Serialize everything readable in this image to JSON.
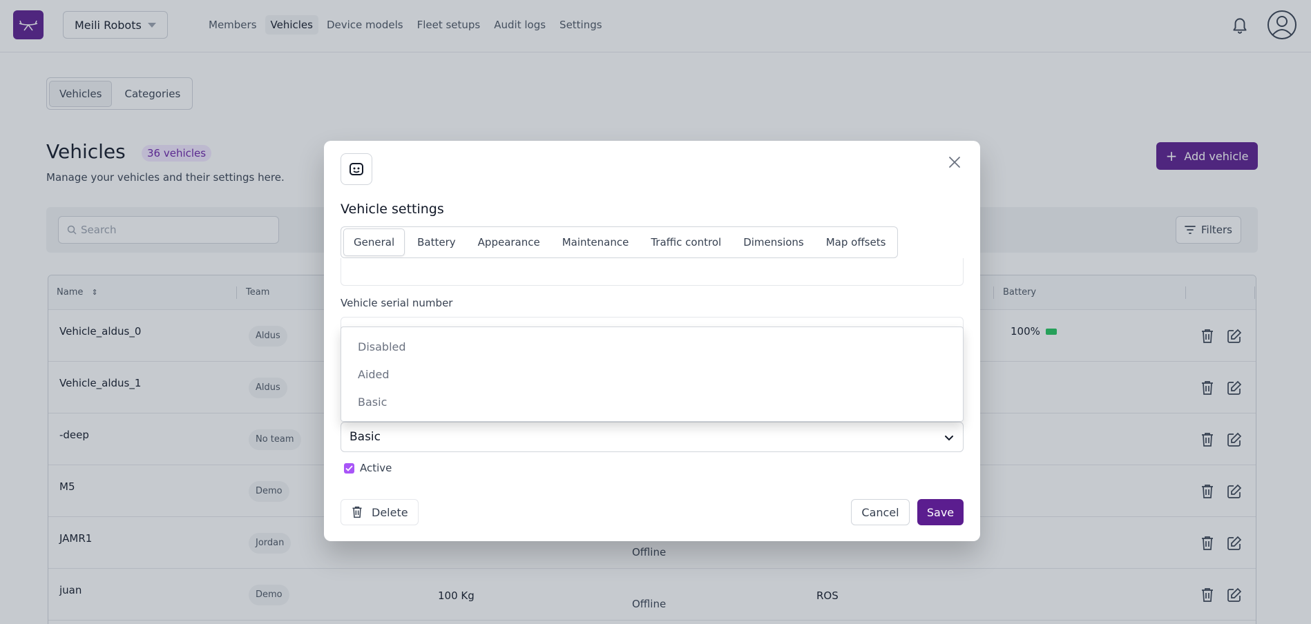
{
  "header": {
    "org_name": "Meili Robots",
    "nav": [
      "Members",
      "Vehicles",
      "Device models",
      "Fleet setups",
      "Audit logs",
      "Settings"
    ],
    "active_nav": "Vehicles"
  },
  "segmented": [
    "Vehicles",
    "Categories"
  ],
  "page": {
    "title": "Vehicles",
    "count_badge": "36 vehicles",
    "subtitle": "Manage your vehicles and their settings here.",
    "add_button": "Add vehicle",
    "search_placeholder": "Search",
    "filters_label": "Filters"
  },
  "table": {
    "headers": {
      "name": "Name",
      "team": "Team",
      "battery": "Battery"
    },
    "rows": [
      {
        "name": "Vehicle_aldus_0",
        "team": "Aldus",
        "payload": "",
        "status": "",
        "protocol": "",
        "battery": "100%"
      },
      {
        "name": "Vehicle_aldus_1",
        "team": "Aldus",
        "payload": "",
        "status": "",
        "protocol": "",
        "battery": ""
      },
      {
        "name": "-deep",
        "team": "No team",
        "payload": "",
        "status": "",
        "protocol": "",
        "battery": ""
      },
      {
        "name": "M5",
        "team": "Demo",
        "payload": "",
        "status": "",
        "protocol": "",
        "battery": ""
      },
      {
        "name": "JAMR1",
        "team": "Jordan",
        "payload": "",
        "status": "Offline",
        "protocol": "",
        "battery": ""
      },
      {
        "name": "juan",
        "team": "Demo",
        "payload": "100 Kg",
        "status": "Offline",
        "protocol": "ROS",
        "battery": ""
      }
    ]
  },
  "modal": {
    "title": "Vehicle settings",
    "tabs": [
      "General",
      "Battery",
      "Appearance",
      "Maintenance",
      "Traffic control",
      "Dimensions",
      "Map offsets"
    ],
    "active_tab": "General",
    "serial_label": "Vehicle serial number",
    "select_value": "Basic",
    "dropdown_options": [
      "Disabled",
      "Aided",
      "Basic"
    ],
    "active_label": "Active",
    "active_checked": true,
    "delete_label": "Delete",
    "cancel_label": "Cancel",
    "save_label": "Save"
  },
  "colors": {
    "brand": "#5b1d8f",
    "checkbox": "#a855f7",
    "battery_full": "#22c55e"
  }
}
